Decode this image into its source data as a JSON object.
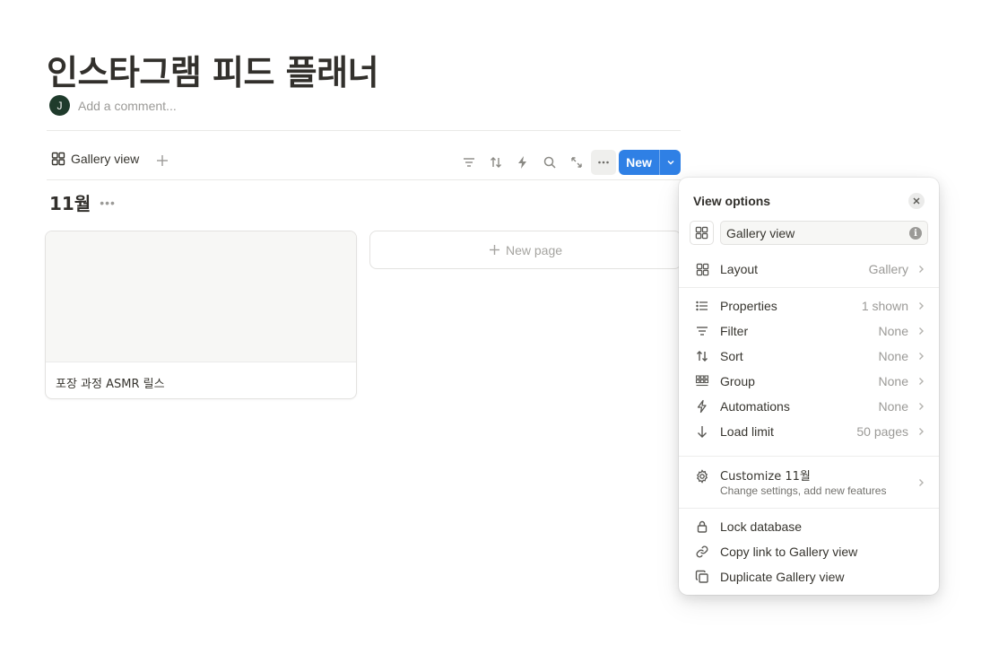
{
  "page": {
    "title": "인스타그램 피드 플래너",
    "avatar_initial": "J",
    "comment_placeholder": "Add a comment..."
  },
  "toolbar": {
    "view_tab_label": "Gallery view",
    "new_label": "New",
    "tools": [
      "filter-icon",
      "sort-icon",
      "lightning-icon",
      "search-icon",
      "expand-icon",
      "more-icon"
    ]
  },
  "group": {
    "title": "11월",
    "more": "•••"
  },
  "gallery": {
    "cards": [
      {
        "title": "포장 과정 ASMR 릴스"
      }
    ],
    "new_page_label": "New page"
  },
  "view_options": {
    "title": "View options",
    "view_name": "Gallery view",
    "layout": {
      "label": "Layout",
      "value": "Gallery"
    },
    "settings": [
      {
        "label": "Properties",
        "value": "1 shown",
        "icon": "list-icon"
      },
      {
        "label": "Filter",
        "value": "None",
        "icon": "filter-icon"
      },
      {
        "label": "Sort",
        "value": "None",
        "icon": "sort-icon"
      },
      {
        "label": "Group",
        "value": "None",
        "icon": "group-icon"
      },
      {
        "label": "Automations",
        "value": "None",
        "icon": "lightning-icon"
      },
      {
        "label": "Load limit",
        "value": "50 pages",
        "icon": "arrow-down-icon"
      }
    ],
    "customize": {
      "title": "Customize 11월",
      "subtitle": "Change settings, add new features"
    },
    "actions": [
      {
        "label": "Lock database",
        "icon": "lock-icon"
      },
      {
        "label": "Copy link to Gallery view",
        "icon": "link-icon"
      },
      {
        "label": "Duplicate Gallery view",
        "icon": "duplicate-icon"
      }
    ]
  },
  "colors": {
    "accent": "#2f80e5",
    "text": "#37352f",
    "muted": "#9b9a97"
  }
}
